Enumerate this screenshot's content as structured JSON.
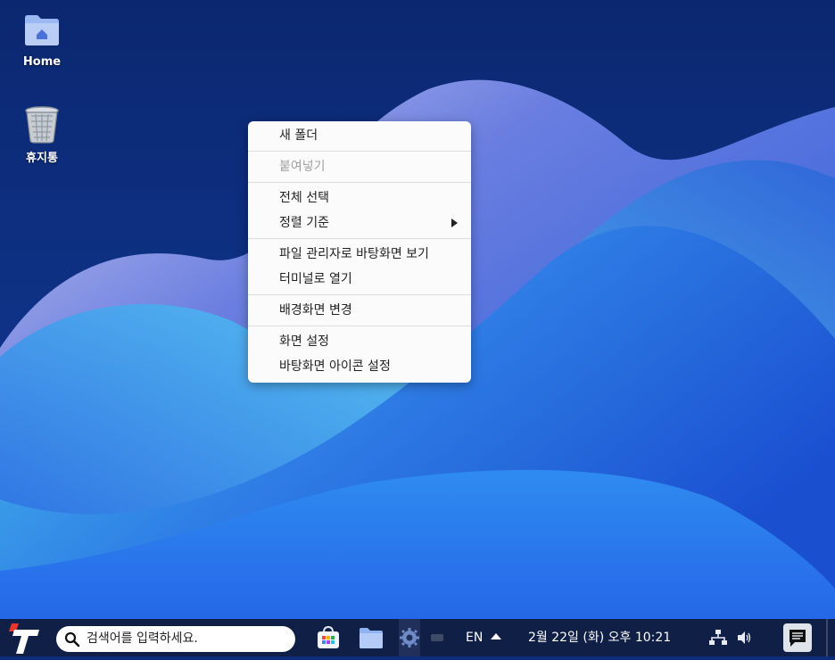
{
  "desktop": {
    "icons": [
      {
        "label": "Home",
        "icon": "home-folder-icon"
      },
      {
        "label": "휴지통",
        "icon": "trash-icon"
      }
    ]
  },
  "context_menu": {
    "items": [
      {
        "label": "새 폴더",
        "enabled": true
      },
      {
        "label": "붙여넣기",
        "enabled": false
      },
      {
        "label": "전체 선택",
        "enabled": true
      },
      {
        "label": "정렬 기준",
        "enabled": true,
        "submenu": true
      },
      {
        "label": "파일 관리자로 바탕화면 보기",
        "enabled": true
      },
      {
        "label": "터미널로 열기",
        "enabled": true
      },
      {
        "label": "배경화면 변경",
        "enabled": true
      },
      {
        "label": "화면 설정",
        "enabled": true
      },
      {
        "label": "바탕화면 아이콘 설정",
        "enabled": true
      }
    ]
  },
  "taskbar": {
    "search_placeholder": "검색어를 입력하세요.",
    "input_method": "EN",
    "clock": "2월 22일 (화) 오후 10:21",
    "apps": [
      "app-store-icon",
      "file-manager-icon",
      "settings-icon"
    ]
  },
  "colors": {
    "taskbar_bg": "#0f1f45",
    "menu_bg": "#fbfbfb",
    "wallpaper_dark": "#0d2d7a",
    "wallpaper_light": "#4fd2ee"
  }
}
